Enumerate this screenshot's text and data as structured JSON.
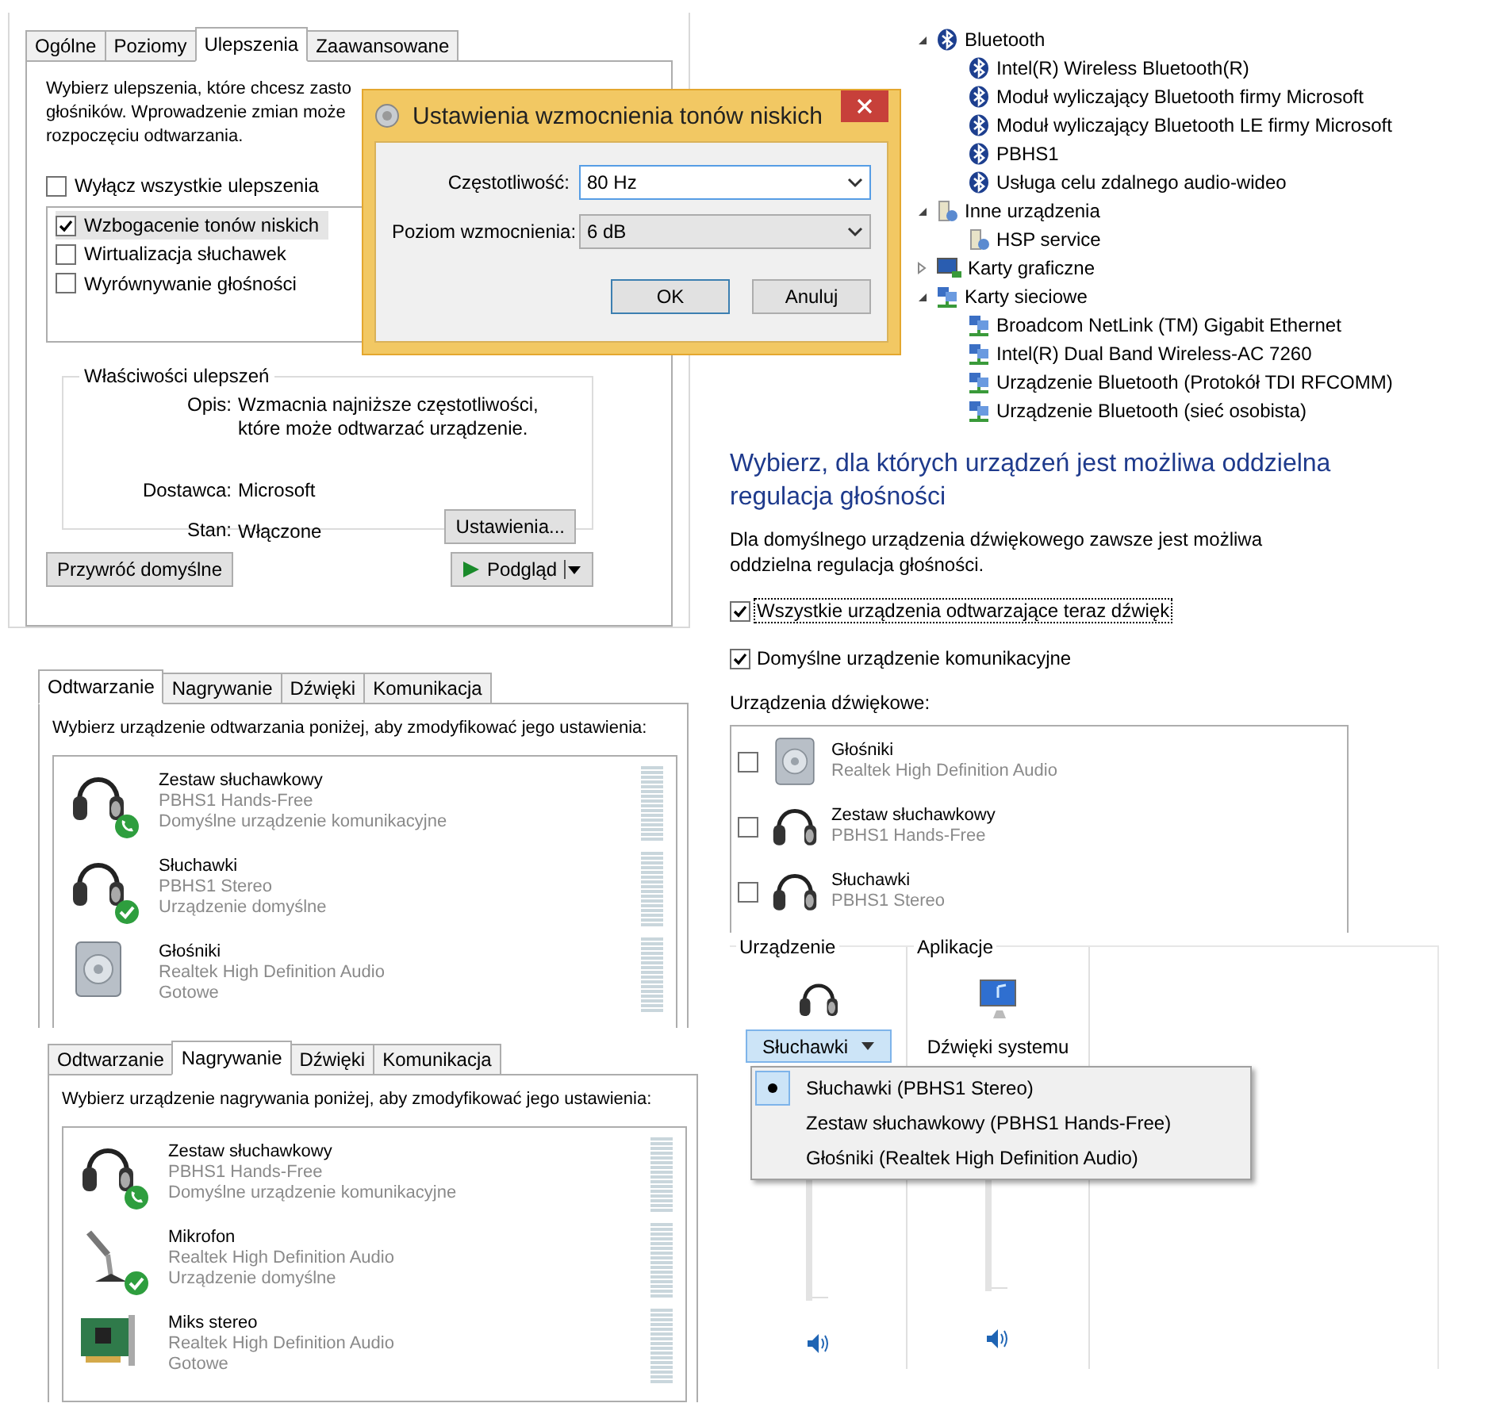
{
  "enhancements_panel": {
    "tabs": [
      {
        "label": "Ogólne",
        "selected": false
      },
      {
        "label": "Poziomy",
        "selected": false
      },
      {
        "label": "Ulepszenia",
        "selected": true
      },
      {
        "label": "Zaawansowane",
        "selected": false
      }
    ],
    "intro_lines": [
      "Wybierz ulepszenia, które chcesz zasto",
      "głośników. Wprowadzenie zmian może",
      "rozpoczęciu odtwarzania."
    ],
    "disable_all": {
      "label": "Wyłącz wszystkie ulepszenia",
      "checked": false
    },
    "enhancements": [
      {
        "label": "Wzbogacenie tonów niskich",
        "checked": true,
        "selected": true
      },
      {
        "label": "Wirtualizacja słuchawek",
        "checked": false,
        "selected": false
      },
      {
        "label": "Wyrównywanie głośności",
        "checked": false,
        "selected": false
      }
    ],
    "properties": {
      "title": "Właściwości ulepszeń",
      "description_label": "Opis:",
      "description": "Wzmacnia najniższe częstotliwości, które może odtwarzać urządzenie.",
      "provider_label": "Dostawca:",
      "provider": "Microsoft",
      "state_label": "Stan:",
      "state": "Włączone",
      "settings_button": "Ustawienia..."
    },
    "restore_button": "Przywróć domyślne",
    "preview_button": "Podgląd"
  },
  "dialog": {
    "title": "Ustawienia wzmocnienia tonów niskich",
    "fields": [
      {
        "label": "Częstotliwość:",
        "value": "80 Hz",
        "focused": true
      },
      {
        "label": "Poziom wzmocnienia:",
        "value": "6 dB",
        "focused": false
      }
    ],
    "buttons": [
      {
        "label": "OK",
        "default": true
      },
      {
        "label": "Anuluj",
        "default": false
      }
    ]
  },
  "playback_panel": {
    "tabs": [
      {
        "label": "Odtwarzanie",
        "selected": true
      },
      {
        "label": "Nagrywanie",
        "selected": false
      },
      {
        "label": "Dźwięki",
        "selected": false
      },
      {
        "label": "Komunikacja",
        "selected": false
      }
    ],
    "instruction": "Wybierz urządzenie odtwarzania poniżej, aby zmodyfikować jego ustawienia:",
    "devices": [
      {
        "name": "Zestaw słuchawkowy",
        "detail": "PBHS1 Hands-Free",
        "status": "Domyślne urządzenie komunikacyjne",
        "kind": "headset",
        "default_communication": true,
        "default": false
      },
      {
        "name": "Słuchawki",
        "detail": "PBHS1 Stereo",
        "status": "Urządzenie domyślne",
        "kind": "headset",
        "default_communication": false,
        "default": true
      },
      {
        "name": "Głośniki",
        "detail": "Realtek High Definition Audio",
        "status": "Gotowe",
        "kind": "speaker",
        "default_communication": false,
        "default": false
      }
    ]
  },
  "recording_panel": {
    "tabs": [
      {
        "label": "Odtwarzanie",
        "selected": false
      },
      {
        "label": "Nagrywanie",
        "selected": true
      },
      {
        "label": "Dźwięki",
        "selected": false
      },
      {
        "label": "Komunikacja",
        "selected": false
      }
    ],
    "instruction": "Wybierz urządzenie nagrywania poniżej, aby zmodyfikować jego ustawienia:",
    "devices": [
      {
        "name": "Zestaw słuchawkowy",
        "detail": "PBHS1 Hands-Free",
        "status": "Domyślne urządzenie komunikacyjne",
        "kind": "headset",
        "default_communication": true,
        "default": false
      },
      {
        "name": "Mikrofon",
        "detail": "Realtek High Definition Audio",
        "status": "Urządzenie domyślne",
        "kind": "microphone",
        "default_communication": false,
        "default": true
      },
      {
        "name": "Miks stereo",
        "detail": "Realtek High Definition Audio",
        "status": "Gotowe",
        "kind": "card",
        "default_communication": false,
        "default": false
      }
    ]
  },
  "device_tree": [
    {
      "label": "Bluetooth",
      "kind": "bluetooth",
      "expanded": true,
      "children": [
        {
          "label": "Intel(R) Wireless Bluetooth(R)",
          "kind": "bluetooth"
        },
        {
          "label": "Moduł wyliczający Bluetooth firmy Microsoft",
          "kind": "bluetooth"
        },
        {
          "label": "Moduł wyliczający Bluetooth LE firmy Microsoft",
          "kind": "bluetooth"
        },
        {
          "label": "PBHS1",
          "kind": "bluetooth"
        },
        {
          "label": "Usługa celu zdalnego audio-wideo",
          "kind": "bluetooth"
        }
      ]
    },
    {
      "label": "Inne urządzenia",
      "kind": "unknown",
      "expanded": true,
      "children": [
        {
          "label": "HSP service",
          "kind": "unknown"
        }
      ]
    },
    {
      "label": "Karty graficzne",
      "kind": "display",
      "expanded": false
    },
    {
      "label": "Karty sieciowe",
      "kind": "network",
      "expanded": true,
      "children": [
        {
          "label": "Broadcom NetLink (TM) Gigabit Ethernet",
          "kind": "network"
        },
        {
          "label": "Intel(R) Dual Band Wireless-AC 7260",
          "kind": "network"
        },
        {
          "label": "Urządzenie Bluetooth (Protokół TDI RFCOMM)",
          "kind": "network"
        },
        {
          "label": "Urządzenie Bluetooth (sieć osobista)",
          "kind": "network"
        }
      ]
    }
  ],
  "volume_settings": {
    "heading": "Wybierz, dla których urządzeń jest możliwa oddzielna regulacja głośności",
    "description": "Dla domyślnego urządzenia dźwiękowego zawsze jest możliwa oddzielna regulacja głośności.",
    "options": [
      {
        "label": "Wszystkie urządzenia odtwarzające teraz dźwięk",
        "checked": true,
        "focused": true
      },
      {
        "label": "Domyślne urządzenie komunikacyjne",
        "checked": true,
        "focused": false
      }
    ],
    "devices_label": "Urządzenia dźwiękowe:",
    "devices": [
      {
        "name": "Głośniki",
        "detail": "Realtek High Definition Audio",
        "kind": "speaker",
        "checked": false
      },
      {
        "name": "Zestaw słuchawkowy",
        "detail": "PBHS1 Hands-Free",
        "kind": "headset",
        "checked": false
      },
      {
        "name": "Słuchawki",
        "detail": "PBHS1 Stereo",
        "kind": "headset",
        "checked": false
      }
    ]
  },
  "mixer": {
    "device_label": "Urządzenie",
    "apps_label": "Aplikacje",
    "device_button": "Słuchawki",
    "app_name": "Dźwięki systemu",
    "menu": [
      {
        "label": "Słuchawki (PBHS1 Stereo)",
        "selected": true
      },
      {
        "label": "Zestaw słuchawkowy (PBHS1 Hands-Free)",
        "selected": false
      },
      {
        "label": "Głośniki (Realtek High Definition Audio)",
        "selected": false
      }
    ]
  }
}
